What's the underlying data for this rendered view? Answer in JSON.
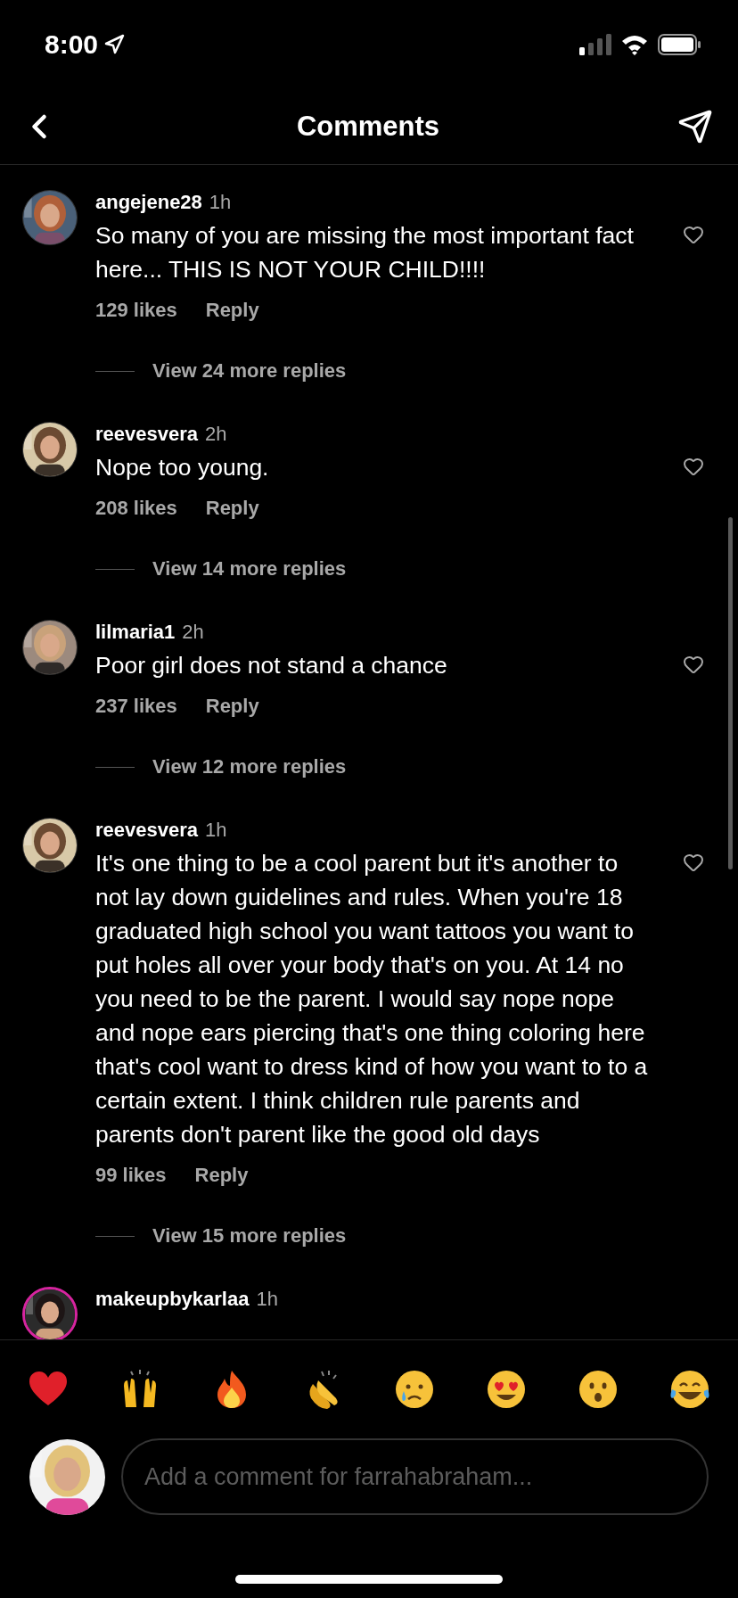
{
  "status_bar": {
    "time": "8:00"
  },
  "header": {
    "title": "Comments"
  },
  "comments": [
    {
      "username": "angejene28",
      "time": "1h",
      "text": "So many of you are missing the most important fact here... THIS IS NOT YOUR CHILD!!!!",
      "likes": "129 likes",
      "reply": "Reply",
      "view_replies": "View 24 more replies",
      "avatar": {
        "kind": "picture",
        "story_ring": false
      }
    },
    {
      "username": "reevesvera",
      "time": "2h",
      "text": "Nope too young.",
      "likes": "208 likes",
      "reply": "Reply",
      "view_replies": "View 14 more replies",
      "avatar": {
        "kind": "picture",
        "story_ring": false
      }
    },
    {
      "username": "lilmaria1",
      "time": "2h",
      "text": "Poor girl does not stand a chance",
      "likes": "237 likes",
      "reply": "Reply",
      "view_replies": "View 12 more replies",
      "avatar": {
        "kind": "picture",
        "story_ring": false
      }
    },
    {
      "username": "reevesvera",
      "time": "1h",
      "text": "It's one thing to be a cool parent but it's another to not lay down guidelines and rules. When you're 18 graduated high school you want tattoos you want to put holes all over your body that's on you. At 14 no you need to be the parent. I would say nope nope and nope ears piercing that's one thing coloring here that's cool want to dress kind of how you want to to a certain extent. I think children rule parents and parents don't parent like the good old days",
      "likes": "99 likes",
      "reply": "Reply",
      "view_replies": "View 15 more replies",
      "avatar": {
        "kind": "picture",
        "story_ring": false
      }
    },
    {
      "username": "makeupbykarlaa",
      "time": "1h",
      "avatar": {
        "kind": "picture",
        "story_ring": true
      }
    }
  ],
  "emoji_bar": [
    {
      "kind": "heart"
    },
    {
      "kind": "raised_hands"
    },
    {
      "kind": "fire"
    },
    {
      "kind": "clap"
    },
    {
      "kind": "crying"
    },
    {
      "kind": "heart_eyes"
    },
    {
      "kind": "surprised"
    },
    {
      "kind": "laughing"
    }
  ],
  "composer": {
    "placeholder": "Add a comment for farrahabraham...",
    "avatar": {
      "kind": "picture"
    }
  }
}
